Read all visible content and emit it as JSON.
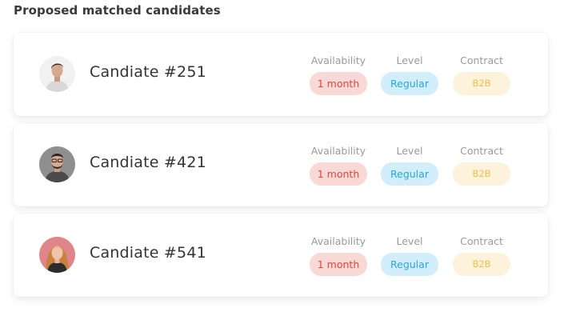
{
  "title": "Proposed matched candidates",
  "labels": {
    "availability": "Availability",
    "level": "Level",
    "contract": "Contract"
  },
  "candidates": [
    {
      "name": "Candiate #251",
      "availability": "1 month",
      "level": "Regular",
      "contract": "B2B",
      "avatar_icon": "person-photo-icon"
    },
    {
      "name": "Candiate #421",
      "availability": "1 month",
      "level": "Regular",
      "contract": "B2B",
      "avatar_icon": "person-photo-icon"
    },
    {
      "name": "Candiate #541",
      "availability": "1 month",
      "level": "Regular",
      "contract": "B2B",
      "avatar_icon": "person-photo-icon"
    }
  ],
  "colors": {
    "availability_bg": "#f8d9d6",
    "availability_text": "#e0463c",
    "level_bg": "#d3eefb",
    "level_text": "#2aa6dc",
    "contract_bg": "#fdf3dc",
    "contract_text": "#f2c048"
  }
}
